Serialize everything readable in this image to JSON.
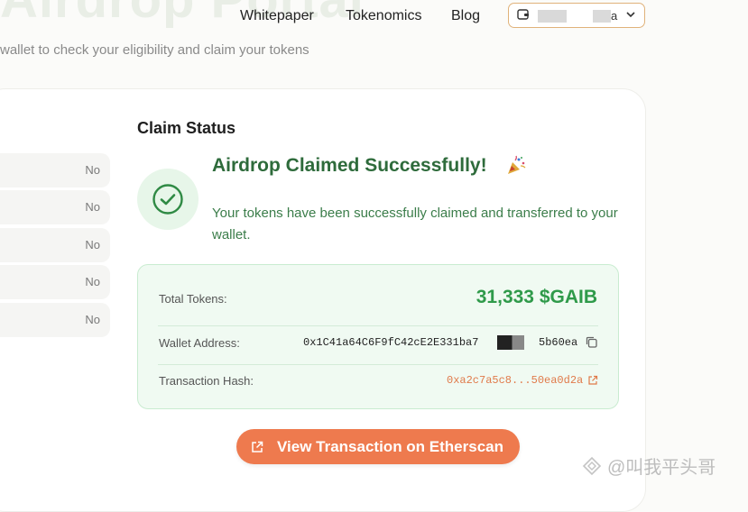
{
  "hero": {
    "title_fragment": "Airdrop Portal"
  },
  "nav": {
    "whitepaper": "Whitepaper",
    "tokenomics": "Tokenomics",
    "blog": "Blog",
    "wallet_suffix": "a"
  },
  "subtitle": "wallet to check your eligibility and claim your tokens",
  "eligibility_rows": [
    "No",
    "No",
    "No",
    "No",
    "No"
  ],
  "claim": {
    "section_title": "Claim Status",
    "success_title": "Airdrop Claimed Successfully!",
    "success_message": "Your tokens have been successfully claimed and transferred to your wallet.",
    "total_tokens_label": "Total Tokens:",
    "total_tokens_value": "31,333 $GAIB",
    "wallet_address_label": "Wallet Address:",
    "wallet_address_prefix": "0x1C41a64C6F9fC42cE2E331ba7",
    "wallet_address_suffix": "5b60ea",
    "tx_hash_label": "Transaction Hash:",
    "tx_hash_value": "0xa2c7a5c8...50ea0d2a",
    "cta_label": "View Transaction on Etherscan"
  },
  "watermark": "@叫我平头哥",
  "colors": {
    "accent_orange": "#ee7a4e",
    "success_green": "#2f9a4a",
    "success_dark_green": "#2e6b3b",
    "info_box_bg": "#f0faf2"
  },
  "icons": {
    "wallet": "wallet-icon",
    "chevron": "chevron-down-icon",
    "check": "check-circle-icon",
    "party": "party-popper-icon",
    "copy": "copy-icon",
    "external": "external-link-icon"
  }
}
